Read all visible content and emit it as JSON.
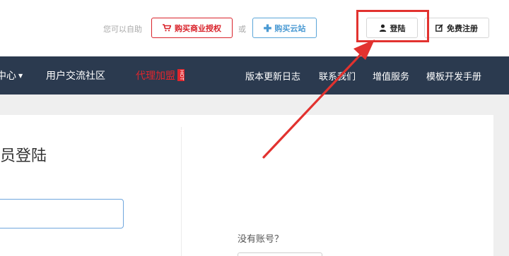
{
  "header": {
    "hint": "您可以自助",
    "buy_license": "购买商业授权",
    "or": "或",
    "buy_cloud": "购买云站",
    "login": "登陆",
    "register": "免费注册"
  },
  "nav": {
    "center_partial": "中心",
    "community": "用户交流社区",
    "agent": "代理加盟",
    "hot_badge": "HOT",
    "changelog": "版本更新日志",
    "contact": "联系我们",
    "value_added": "增值服务",
    "template_manual": "模板开发手册"
  },
  "main": {
    "login_title_partial": "员登陆",
    "no_account": "没有账号？"
  },
  "colors": {
    "navbar": "#2b3a4f",
    "accent_red": "#e0262d",
    "accent_blue": "#4a9ad3",
    "highlight": "#e2322f"
  },
  "icons": [
    "cart-icon",
    "plus-icon",
    "user-icon",
    "edit-icon",
    "caret-down-icon"
  ]
}
